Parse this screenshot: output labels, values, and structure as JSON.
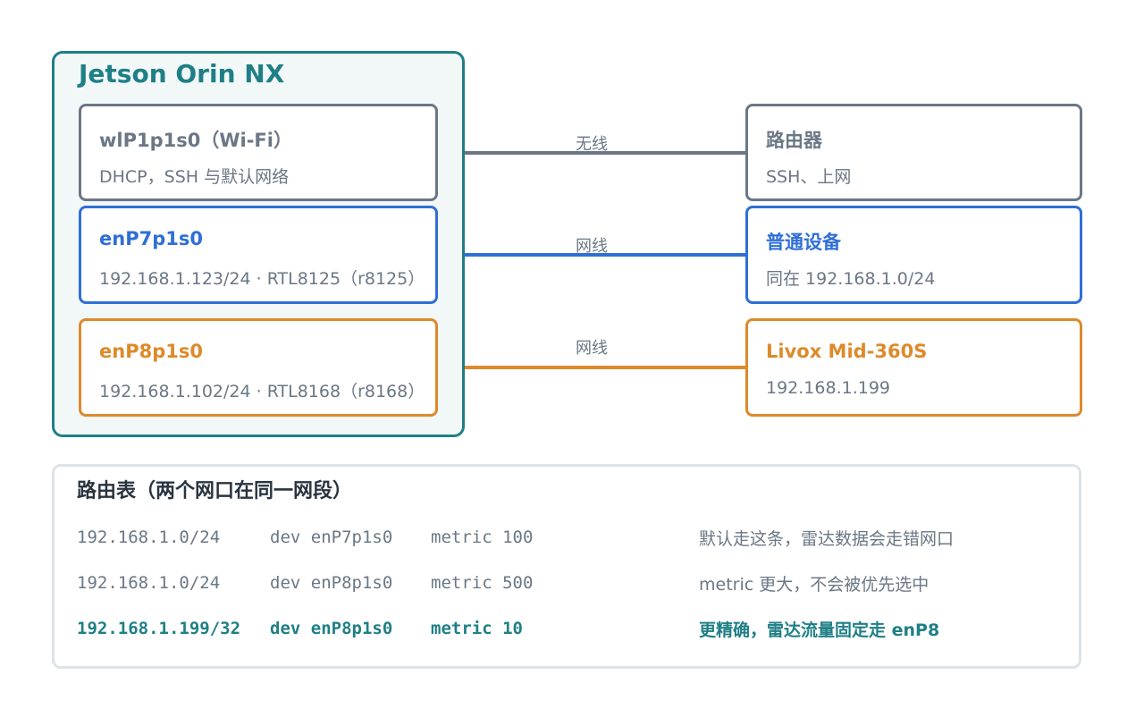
{
  "host": {
    "title": "Jetson Orin NX"
  },
  "interfaces": [
    {
      "name": "wlP1p1s0（Wi-Fi）",
      "detail": "DHCP，SSH 与默认网络",
      "color": "#6b7785"
    },
    {
      "name": "enP7p1s0",
      "detail": "192.168.1.123/24 · RTL8125（r8125）",
      "color": "#2f6fd6"
    },
    {
      "name": "enP8p1s0",
      "detail": "192.168.1.102/24 · RTL8168（r8168）",
      "color": "#dd8a2b"
    }
  ],
  "links": [
    {
      "label": "无线"
    },
    {
      "label": "网线"
    },
    {
      "label": "网线"
    }
  ],
  "peers": [
    {
      "name": "路由器",
      "detail": "SSH、上网"
    },
    {
      "name": "普通设备",
      "detail": "同在 192.168.1.0/24"
    },
    {
      "name": "Livox Mid-360S",
      "detail": "192.168.1.199"
    }
  ],
  "route_table": {
    "title": "路由表（两个网口在同一网段）",
    "rows": [
      {
        "dest": "192.168.1.0/24",
        "dev": "dev enP7p1s0",
        "metric": "metric 100",
        "note": "默认走这条，雷达数据会走错网口"
      },
      {
        "dest": "192.168.1.0/24",
        "dev": "dev enP8p1s0",
        "metric": "metric 500",
        "note": "metric 更大，不会被优先选中"
      },
      {
        "dest": "192.168.1.199/32",
        "dev": "dev enP8p1s0",
        "metric": "metric 10",
        "note": "更精确，雷达流量固定走 enP8"
      }
    ]
  }
}
